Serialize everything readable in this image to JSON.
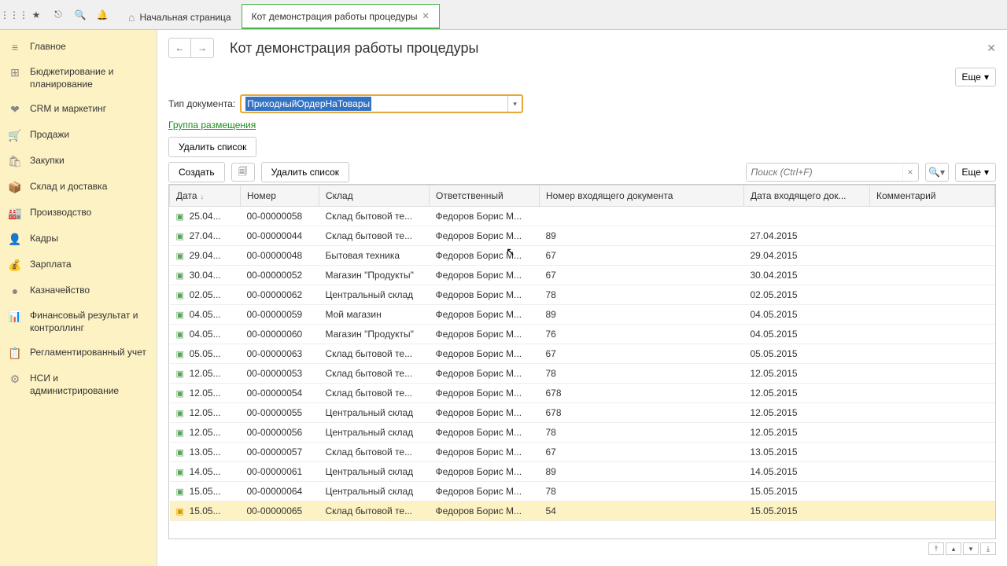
{
  "toolbar_icons": [
    "apps",
    "star",
    "link",
    "search",
    "bell"
  ],
  "tabs": [
    {
      "label": "Начальная страница",
      "icon": "home",
      "active": false
    },
    {
      "label": "Кот демонстрация работы процедуры",
      "active": true,
      "closable": true
    }
  ],
  "sidebar": [
    {
      "icon": "≡",
      "label": "Главное"
    },
    {
      "icon": "⊞",
      "label": "Бюджетирование и планирование"
    },
    {
      "icon": "❤",
      "label": "CRM и маркетинг"
    },
    {
      "icon": "🛒",
      "label": "Продажи"
    },
    {
      "icon": "🛍",
      "label": "Закупки"
    },
    {
      "icon": "📦",
      "label": "Склад и доставка"
    },
    {
      "icon": "🏭",
      "label": "Производство"
    },
    {
      "icon": "👤",
      "label": "Кадры"
    },
    {
      "icon": "💰",
      "label": "Зарплата"
    },
    {
      "icon": "●",
      "label": "Казначейство"
    },
    {
      "icon": "📊",
      "label": "Финансовый результат и контроллинг"
    },
    {
      "icon": "📋",
      "label": "Регламентированный учет"
    },
    {
      "icon": "⚙",
      "label": "НСИ и администрирование"
    }
  ],
  "page": {
    "title": "Кот демонстрация работы процедуры",
    "more": "Еще",
    "doc_type_label": "Тип документа:",
    "doc_type_value": "ПриходныйОрдерНаТовары",
    "group_link": "Группа размещения",
    "delete_list": "Удалить список",
    "create": "Создать",
    "search_ph": "Поиск (Ctrl+F)"
  },
  "columns": [
    "Дата",
    "Номер",
    "Склад",
    "Ответственный",
    "Номер входящего документа",
    "Дата входящего док...",
    "Комментарий"
  ],
  "rows": [
    {
      "date": "25.04...",
      "num": "00-00000058",
      "wh": "Склад бытовой те...",
      "resp": "Федоров Борис М...",
      "inum": "",
      "idate": "",
      "c": ""
    },
    {
      "date": "27.04...",
      "num": "00-00000044",
      "wh": "Склад бытовой те...",
      "resp": "Федоров Борис М...",
      "inum": "89",
      "idate": "27.04.2015",
      "c": ""
    },
    {
      "date": "29.04...",
      "num": "00-00000048",
      "wh": "Бытовая техника",
      "resp": "Федоров Борис М...",
      "inum": "67",
      "idate": "29.04.2015",
      "c": ""
    },
    {
      "date": "30.04...",
      "num": "00-00000052",
      "wh": "Магазин \"Продукты\"",
      "resp": "Федоров Борис М...",
      "inum": "67",
      "idate": "30.04.2015",
      "c": ""
    },
    {
      "date": "02.05...",
      "num": "00-00000062",
      "wh": "Центральный склад",
      "resp": "Федоров Борис М...",
      "inum": "78",
      "idate": "02.05.2015",
      "c": ""
    },
    {
      "date": "04.05...",
      "num": "00-00000059",
      "wh": "Мой магазин",
      "resp": "Федоров Борис М...",
      "inum": "89",
      "idate": "04.05.2015",
      "c": ""
    },
    {
      "date": "04.05...",
      "num": "00-00000060",
      "wh": "Магазин \"Продукты\"",
      "resp": "Федоров Борис М...",
      "inum": "76",
      "idate": "04.05.2015",
      "c": ""
    },
    {
      "date": "05.05...",
      "num": "00-00000063",
      "wh": "Склад бытовой те...",
      "resp": "Федоров Борис М...",
      "inum": "67",
      "idate": "05.05.2015",
      "c": ""
    },
    {
      "date": "12.05...",
      "num": "00-00000053",
      "wh": "Склад бытовой те...",
      "resp": "Федоров Борис М...",
      "inum": "78",
      "idate": "12.05.2015",
      "c": ""
    },
    {
      "date": "12.05...",
      "num": "00-00000054",
      "wh": "Склад бытовой те...",
      "resp": "Федоров Борис М...",
      "inum": "678",
      "idate": "12.05.2015",
      "c": ""
    },
    {
      "date": "12.05...",
      "num": "00-00000055",
      "wh": "Центральный склад",
      "resp": "Федоров Борис М...",
      "inum": "678",
      "idate": "12.05.2015",
      "c": ""
    },
    {
      "date": "12.05...",
      "num": "00-00000056",
      "wh": "Центральный склад",
      "resp": "Федоров Борис М...",
      "inum": "78",
      "idate": "12.05.2015",
      "c": ""
    },
    {
      "date": "13.05...",
      "num": "00-00000057",
      "wh": "Склад бытовой те...",
      "resp": "Федоров Борис М...",
      "inum": "67",
      "idate": "13.05.2015",
      "c": ""
    },
    {
      "date": "14.05...",
      "num": "00-00000061",
      "wh": "Центральный склад",
      "resp": "Федоров Борис М...",
      "inum": "89",
      "idate": "14.05.2015",
      "c": ""
    },
    {
      "date": "15.05...",
      "num": "00-00000064",
      "wh": "Центральный склад",
      "resp": "Федоров Борис М...",
      "inum": "78",
      "idate": "15.05.2015",
      "c": ""
    },
    {
      "date": "15.05...",
      "num": "00-00000065",
      "wh": "Склад бытовой те...",
      "resp": "Федоров Борис М...",
      "inum": "54",
      "idate": "15.05.2015",
      "c": "",
      "selected": true
    }
  ]
}
